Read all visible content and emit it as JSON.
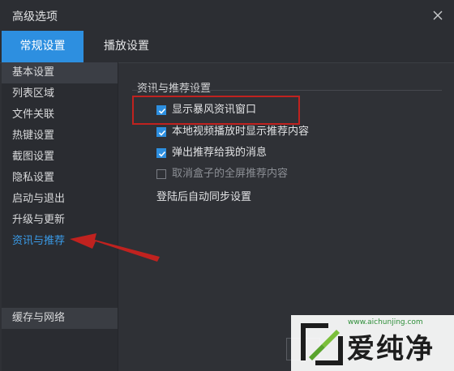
{
  "window": {
    "title": "高级选项"
  },
  "tabs": [
    {
      "label": "常规设置",
      "active": true
    },
    {
      "label": "播放设置",
      "active": false
    }
  ],
  "sidebar": {
    "items": [
      {
        "label": "基本设置"
      },
      {
        "label": "列表区域"
      },
      {
        "label": "文件关联"
      },
      {
        "label": "热键设置"
      },
      {
        "label": "截图设置"
      },
      {
        "label": "隐私设置"
      },
      {
        "label": "启动与退出"
      },
      {
        "label": "升级与更新"
      },
      {
        "label": "资讯与推荐"
      }
    ],
    "bottom_item": "缓存与网络"
  },
  "section": {
    "title": "资讯与推荐设置",
    "options": [
      {
        "label": "显示暴风资讯窗口",
        "checked": true
      },
      {
        "label": "本地视频播放时显示推荐内容",
        "checked": true
      },
      {
        "label": "弹出推荐给我的消息",
        "checked": true
      },
      {
        "label": "取消盒子的全屏推荐内容",
        "checked": false,
        "disabled": true
      }
    ],
    "plain_option": "登陆后自动同步设置"
  },
  "watermark": {
    "url": "www.aichunjing.com",
    "text": "爱纯净"
  },
  "colors": {
    "accent": "#2d8fe0",
    "highlight_red": "#c0221f",
    "background": "#2f3136"
  },
  "icons": {
    "close": "close-icon",
    "check": "check-icon",
    "arrow": "red-arrow-annotation",
    "logo": "aichunjing-logo"
  }
}
